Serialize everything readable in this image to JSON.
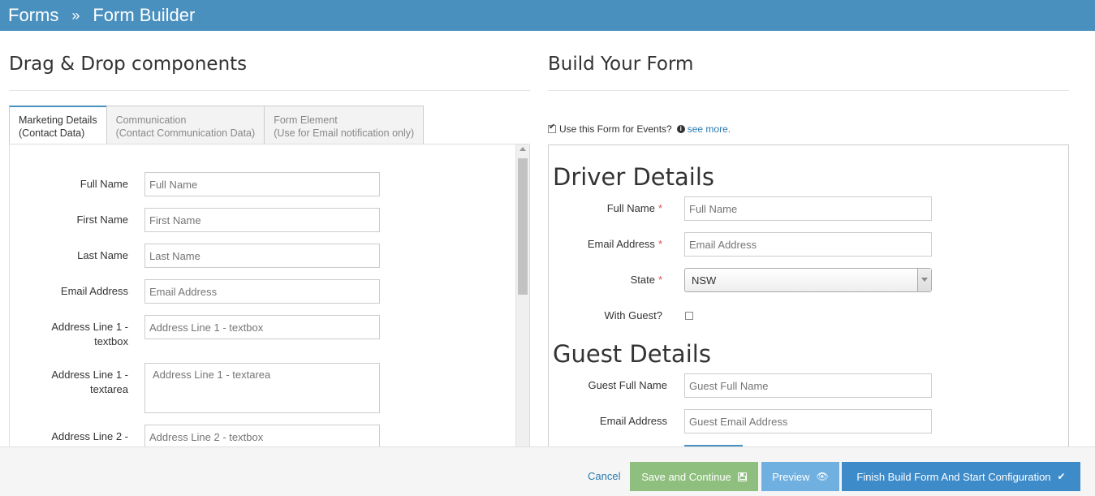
{
  "header": {
    "section": "Forms",
    "separator": "»",
    "page": "Form Builder"
  },
  "left": {
    "title": "Drag & Drop components",
    "tabs": [
      {
        "line1": "Marketing Details",
        "line2": "(Contact Data)"
      },
      {
        "line1": "Communication",
        "line2": "(Contact Communication Data)"
      },
      {
        "line1": "Form Element",
        "line2": "(Use for Email notification only)"
      }
    ],
    "fields": [
      {
        "label": "Full Name",
        "placeholder": "Full Name"
      },
      {
        "label": "First Name",
        "placeholder": "First Name"
      },
      {
        "label": "Last Name",
        "placeholder": "Last Name"
      },
      {
        "label": "Email Address",
        "placeholder": "Email Address"
      },
      {
        "label": "Address Line 1 - textbox",
        "placeholder": "Address Line 1 - textbox"
      },
      {
        "label": "Address Line 1 - textarea",
        "placeholder": "Address Line 1 - textarea"
      },
      {
        "label": "Address Line 2 -",
        "placeholder": "Address Line 2 - textbox"
      }
    ]
  },
  "right": {
    "title": "Build Your Form",
    "events_label": "Use this Form for Events?",
    "see_more": "see more.",
    "driver_heading": "Driver Details",
    "driver_fields": {
      "full_name": {
        "label": "Full Name",
        "placeholder": "Full Name"
      },
      "email": {
        "label": "Email Address",
        "placeholder": "Email Address"
      },
      "state": {
        "label": "State",
        "value": "NSW"
      },
      "guest": {
        "label": "With Guest?"
      }
    },
    "required_mark": "*",
    "guest_heading": "Guest Details",
    "guest_fields": {
      "full_name": {
        "label": "Guest Full Name",
        "placeholder": "Guest Full Name"
      },
      "email": {
        "label": "Email Address",
        "placeholder": "Guest Email Address"
      }
    }
  },
  "footer": {
    "cancel": "Cancel",
    "save": "Save and Continue",
    "preview": "Preview",
    "finish": "Finish Build Form And Start Configuration"
  },
  "colors": {
    "header": "#4a90bf",
    "save": "#8ebf7e",
    "preview": "#70b0e0",
    "finish": "#3d8bc9"
  }
}
